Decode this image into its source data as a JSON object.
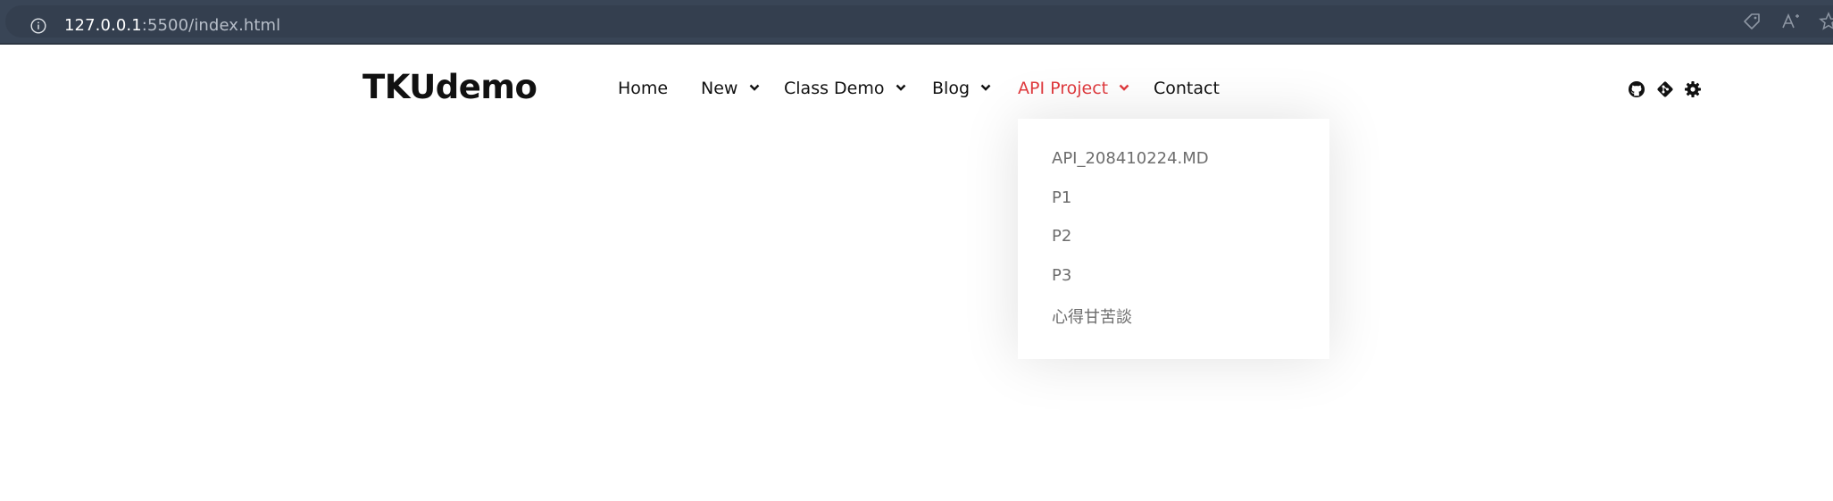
{
  "browser": {
    "url_host": "127.0.0.1",
    "url_rest": ":5500/index.html",
    "icons": [
      "info-icon",
      "tag-icon",
      "read-aloud-icon",
      "favorite-star-icon"
    ]
  },
  "header": {
    "logo": "TKUdemo",
    "nav": [
      {
        "label": "Home",
        "has_dropdown": false
      },
      {
        "label": "New",
        "has_dropdown": true
      },
      {
        "label": "Class Demo",
        "has_dropdown": true
      },
      {
        "label": "Blog",
        "has_dropdown": true
      },
      {
        "label": "API Project",
        "has_dropdown": true,
        "active": true
      },
      {
        "label": "Contact",
        "has_dropdown": false
      }
    ],
    "right_icons": [
      "github-icon",
      "git-icon",
      "gear-icon"
    ],
    "active_color": "#e03a3e"
  },
  "dropdown": {
    "items": [
      "API_208410224.MD",
      "P1",
      "P2",
      "P3",
      "心得甘苦談"
    ]
  }
}
